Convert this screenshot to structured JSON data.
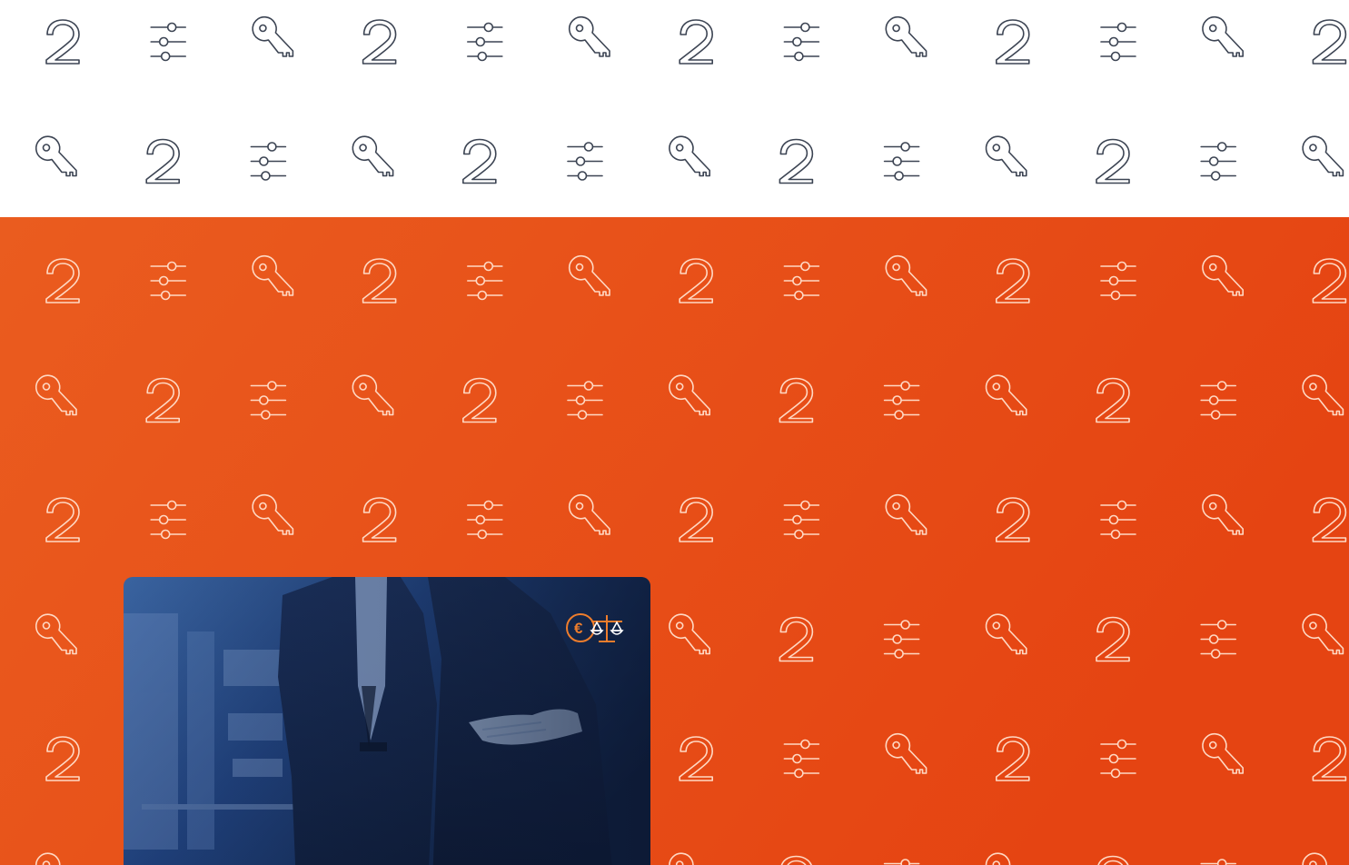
{
  "pattern": {
    "icon_sequence": [
      "number-two-icon",
      "sliders-icon",
      "key-icon"
    ],
    "light_stroke": "#3c4453",
    "dark_stroke": "#ffd9c4"
  },
  "hero": {
    "gradient_start": "#ea5c1f",
    "gradient_end": "#e54412"
  },
  "photo_card": {
    "image": "business-people-fingers-crossed-photo",
    "overlay_color": "#1d3d7a",
    "logo": {
      "icon": "euro-scales-icon",
      "color": "#ee7d2c"
    }
  }
}
